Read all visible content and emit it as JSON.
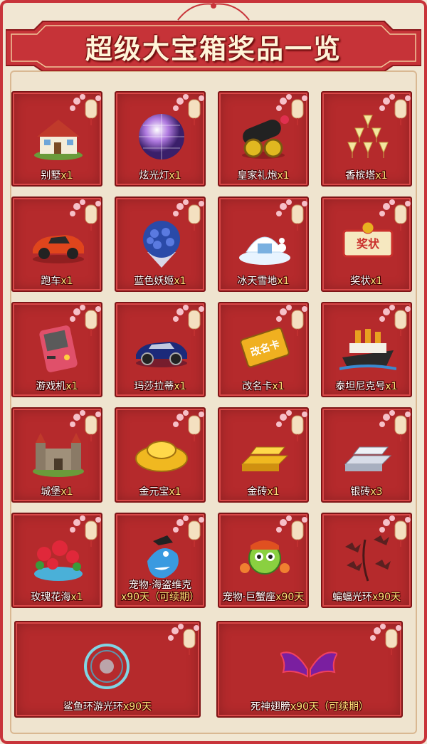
{
  "title": "超级大宝箱奖品一览",
  "colors": {
    "frame": "#c8343a",
    "card": "#b52a2c",
    "qty": "#ffe37a",
    "background": "#f1e7d3"
  },
  "items": [
    {
      "name": "别墅",
      "qty": "x1",
      "icon": "villa-icon"
    },
    {
      "name": "炫光灯",
      "qty": "x1",
      "icon": "disco-ball-icon"
    },
    {
      "name": "皇家礼炮",
      "qty": "x1",
      "icon": "cannon-icon"
    },
    {
      "name": "香槟塔",
      "qty": "x1",
      "icon": "champagne-tower-icon"
    },
    {
      "name": "跑车",
      "qty": "x1",
      "icon": "sports-car-icon"
    },
    {
      "name": "蓝色妖姬",
      "qty": "x1",
      "icon": "blue-rose-bouquet-icon"
    },
    {
      "name": "冰天雪地",
      "qty": "x1",
      "icon": "snow-land-icon"
    },
    {
      "name": "奖状",
      "qty": "x1",
      "icon": "certificate-icon"
    },
    {
      "name": "游戏机",
      "qty": "x1",
      "icon": "game-console-icon"
    },
    {
      "name": "玛莎拉蒂",
      "qty": "x1",
      "icon": "maserati-car-icon"
    },
    {
      "name": "改名卡",
      "qty": "x1",
      "icon": "rename-card-icon"
    },
    {
      "name": "泰坦尼克号",
      "qty": "x1",
      "icon": "titanic-ship-icon"
    },
    {
      "name": "城堡",
      "qty": "x1",
      "icon": "castle-icon"
    },
    {
      "name": "金元宝",
      "qty": "x1",
      "icon": "gold-ingot-icon"
    },
    {
      "name": "金砖",
      "qty": "x1",
      "icon": "gold-bar-icon"
    },
    {
      "name": "银砖",
      "qty": "x3",
      "icon": "silver-bar-icon"
    },
    {
      "name": "玫瑰花海",
      "qty": "x1",
      "icon": "rose-garden-icon"
    },
    {
      "name": "宠物·海盗维克",
      "qty": "x90天（可续期）",
      "icon": "pirate-shark-pet-icon"
    },
    {
      "name": "宠物·巨蟹座",
      "qty": "x90天",
      "icon": "cancer-pet-icon"
    },
    {
      "name": "蝙蝠光环",
      "qty": "x90天",
      "icon": "bat-halo-icon"
    }
  ],
  "wide_items": [
    {
      "name": "鲨鱼环游光环",
      "qty": "x90天",
      "icon": "shark-halo-icon"
    },
    {
      "name": "死神翅膀",
      "qty": "x90天（可续期）",
      "icon": "death-wings-icon"
    }
  ]
}
